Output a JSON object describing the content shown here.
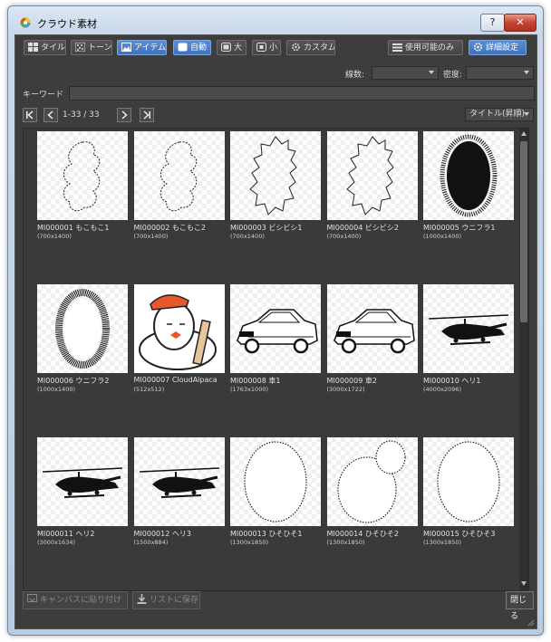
{
  "window": {
    "title": "クラウド素材",
    "help_label": "?",
    "close_label": "✕"
  },
  "toolbar": {
    "tile_label": "タイル",
    "tone_label": "トーン",
    "item_label": "アイテム",
    "auto_label": "自動",
    "large_label": "大",
    "small_label": "小",
    "custom_label": "カスタム",
    "available_only_label": "使用可能のみ",
    "detail_settings_label": "詳細設定"
  },
  "filters": {
    "lines_label": "線数:",
    "lines_value": "",
    "density_label": "密度:",
    "density_value": "",
    "keyword_label": "キーワード",
    "keyword_value": ""
  },
  "pager": {
    "range_text": "1-33 / 33",
    "sort_value": "タイトル(昇順)"
  },
  "items": [
    {
      "name": "MI000001 もこもこ1",
      "size": "(700x1400)",
      "icon": "cloud-outline"
    },
    {
      "name": "MI000002 もこもこ2",
      "size": "(700x1400)",
      "icon": "cloud-outline"
    },
    {
      "name": "MI000003 ビシビシ1",
      "size": "(700x1400)",
      "icon": "spiky-outline"
    },
    {
      "name": "MI000004 ビシビシ2",
      "size": "(700x1400)",
      "icon": "spiky-outline"
    },
    {
      "name": "MI000005 ウニフラ1",
      "size": "(1000x1400)",
      "icon": "urchin-burst"
    },
    {
      "name": "MI000006 ウニフラ2",
      "size": "(1000x1400)",
      "icon": "urchin-ring"
    },
    {
      "name": "MI000007 CloudAlpaca",
      "size": "(512x512)",
      "icon": "alpaca-mascot"
    },
    {
      "name": "MI000008 車1",
      "size": "(1763x1000)",
      "icon": "car-drawing"
    },
    {
      "name": "MI000009 車2",
      "size": "(3000x1722)",
      "icon": "car-drawing"
    },
    {
      "name": "MI000010 ヘリ1",
      "size": "(4000x2096)",
      "icon": "helicopter"
    },
    {
      "name": "MI000011 ヘリ2",
      "size": "(3000x1634)",
      "icon": "helicopter"
    },
    {
      "name": "MI000012 ヘリ3",
      "size": "(1500x884)",
      "icon": "helicopter"
    },
    {
      "name": "MI000013 ひそひそ1",
      "size": "(1300x1850)",
      "icon": "dotted-oval"
    },
    {
      "name": "MI000014 ひそひそ2",
      "size": "(1300x1850)",
      "icon": "dotted-double-oval"
    },
    {
      "name": "MI000015 ひそひそ3",
      "size": "(1300x1850)",
      "icon": "dotted-oval"
    }
  ],
  "footer": {
    "paste_to_canvas_label": "キャンバスに貼り付け",
    "save_to_list_label": "リストに保存",
    "close_label": "閉じる"
  },
  "colors": {
    "accent": "#4a7fc6",
    "panel": "#3d3d3d",
    "close_red": "#c74432"
  }
}
